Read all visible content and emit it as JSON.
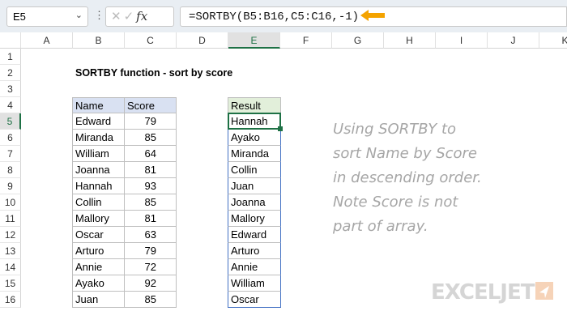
{
  "formula_bar": {
    "name_box": "E5",
    "formula": "=SORTBY(B5:B16,C5:C16,-1)",
    "fx_label": "fx",
    "arrow_color": "#f4a300"
  },
  "columns": [
    "A",
    "B",
    "C",
    "D",
    "E",
    "F",
    "G",
    "H",
    "I",
    "J",
    "K"
  ],
  "rows": [
    "1",
    "2",
    "3",
    "4",
    "5",
    "6",
    "7",
    "8",
    "9",
    "10",
    "11",
    "12",
    "13",
    "14",
    "15",
    "16"
  ],
  "title": "SORTBY function - sort by score",
  "table": {
    "headers": [
      "Name",
      "Score"
    ],
    "rows": [
      [
        "Edward",
        "79"
      ],
      [
        "Miranda",
        "85"
      ],
      [
        "William",
        "64"
      ],
      [
        "Joanna",
        "81"
      ],
      [
        "Hannah",
        "93"
      ],
      [
        "Collin",
        "85"
      ],
      [
        "Mallory",
        "81"
      ],
      [
        "Oscar",
        "63"
      ],
      [
        "Arturo",
        "79"
      ],
      [
        "Annie",
        "72"
      ],
      [
        "Ayako",
        "92"
      ],
      [
        "Juan",
        "85"
      ]
    ]
  },
  "result": {
    "header": "Result",
    "values": [
      "Hannah",
      "Ayako",
      "Miranda",
      "Collin",
      "Juan",
      "Joanna",
      "Mallory",
      "Edward",
      "Arturo",
      "Annie",
      "William",
      "Oscar"
    ]
  },
  "note": "Using SORTBY to\nsort Name by Score\nin descending order.\nNote Score is not\npart of array.",
  "logo": "EXCELJET"
}
